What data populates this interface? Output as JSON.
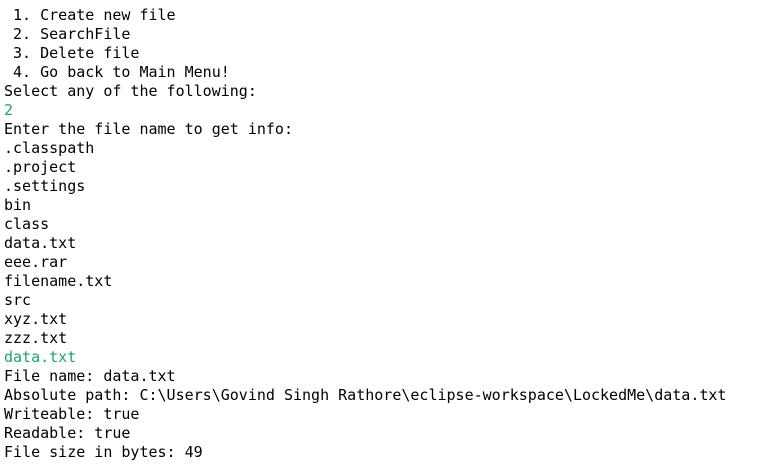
{
  "console": {
    "lines": [
      {
        "text": " 1. Create new file",
        "kind": "output"
      },
      {
        "text": " 2. SearchFile",
        "kind": "output"
      },
      {
        "text": " 3. Delete file",
        "kind": "output"
      },
      {
        "text": " 4. Go back to Main Menu!",
        "kind": "output"
      },
      {
        "text": "Select any of the following:",
        "kind": "output"
      },
      {
        "text": "2",
        "kind": "input"
      },
      {
        "text": "Enter the file name to get info:",
        "kind": "output"
      },
      {
        "text": ".classpath",
        "kind": "output"
      },
      {
        "text": ".project",
        "kind": "output"
      },
      {
        "text": ".settings",
        "kind": "output"
      },
      {
        "text": "bin",
        "kind": "output"
      },
      {
        "text": "class",
        "kind": "output"
      },
      {
        "text": "data.txt",
        "kind": "output"
      },
      {
        "text": "eee.rar",
        "kind": "output"
      },
      {
        "text": "filename.txt",
        "kind": "output"
      },
      {
        "text": "src",
        "kind": "output"
      },
      {
        "text": "xyz.txt",
        "kind": "output"
      },
      {
        "text": "zzz.txt",
        "kind": "output"
      },
      {
        "text": "data.txt",
        "kind": "input"
      },
      {
        "text": "File name: data.txt",
        "kind": "output"
      },
      {
        "text": "Absolute path: C:\\Users\\Govind Singh Rathore\\eclipse-workspace\\LockedMe\\data.txt",
        "kind": "output"
      },
      {
        "text": "Writeable: true",
        "kind": "output"
      },
      {
        "text": "Readable: true",
        "kind": "output"
      },
      {
        "text": "File size in bytes: 49",
        "kind": "output"
      }
    ],
    "colors": {
      "output": "#000000",
      "input": "#1aa37a",
      "background": "#ffffff"
    }
  }
}
